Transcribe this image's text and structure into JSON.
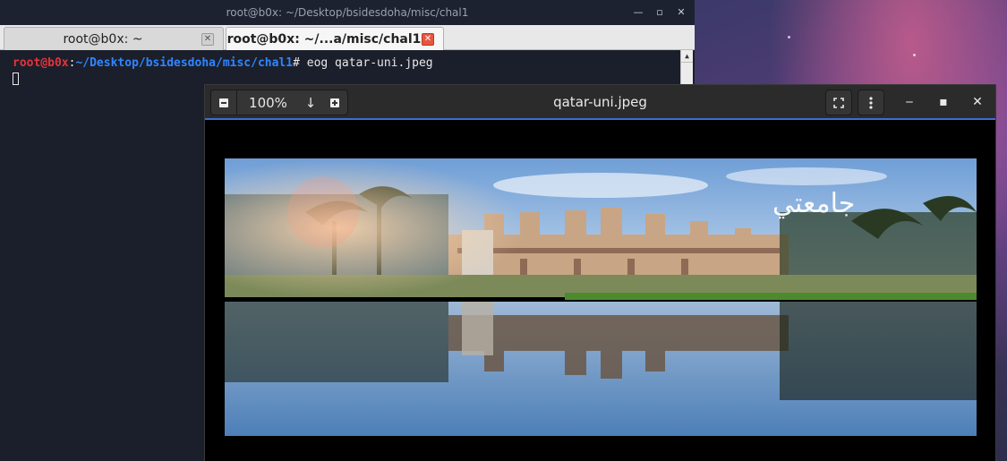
{
  "terminal": {
    "title": "root@b0x: ~/Desktop/bsidesdoha/misc/chal1",
    "tabs": [
      {
        "label": "root@b0x: ~"
      },
      {
        "label": "root@b0x: ~/...a/misc/chal1"
      }
    ],
    "prompt": {
      "user": "root@b0x",
      "sep": ":",
      "path": "~/Desktop/bsidesdoha/misc/chal1",
      "symbol": "#",
      "command": " eog qatar-uni.jpeg"
    }
  },
  "viewer": {
    "title": "qatar-uni.jpeg",
    "zoom": "100%",
    "accent": "#3a6fd8",
    "image_text": "جامعتي"
  }
}
